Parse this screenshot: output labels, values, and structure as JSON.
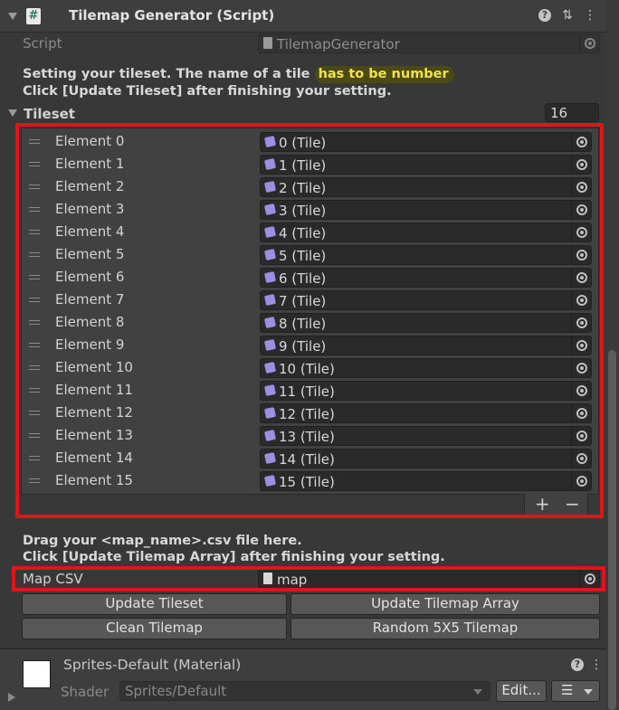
{
  "component": {
    "title": "Tilemap Generator (Script)",
    "script_label": "Script",
    "script_value": "TilemapGenerator",
    "help_line1_a": "Setting your tileset. The name of a tile ",
    "help_line1_highlight": "has to be number",
    "help_line2": "Click [Update Tileset] after finishing your setting.",
    "tileset_label": "Tileset",
    "tileset_size": "16",
    "elements": [
      {
        "name": "Element 0",
        "value": "0 (Tile)"
      },
      {
        "name": "Element 1",
        "value": "1 (Tile)"
      },
      {
        "name": "Element 2",
        "value": "2 (Tile)"
      },
      {
        "name": "Element 3",
        "value": "3 (Tile)"
      },
      {
        "name": "Element 4",
        "value": "4 (Tile)"
      },
      {
        "name": "Element 5",
        "value": "5 (Tile)"
      },
      {
        "name": "Element 6",
        "value": "6 (Tile)"
      },
      {
        "name": "Element 7",
        "value": "7 (Tile)"
      },
      {
        "name": "Element 8",
        "value": "8 (Tile)"
      },
      {
        "name": "Element 9",
        "value": "9 (Tile)"
      },
      {
        "name": "Element 10",
        "value": "10 (Tile)"
      },
      {
        "name": "Element 11",
        "value": "11 (Tile)"
      },
      {
        "name": "Element 12",
        "value": "12 (Tile)"
      },
      {
        "name": "Element 13",
        "value": "13 (Tile)"
      },
      {
        "name": "Element 14",
        "value": "14 (Tile)"
      },
      {
        "name": "Element 15",
        "value": "15 (Tile)"
      }
    ],
    "add_symbol": "+",
    "remove_symbol": "−",
    "csv_help_line1": "Drag your <map_name>.csv file here.",
    "csv_help_line2": "Click [Update Tilemap Array] after finishing your setting.",
    "map_csv_label": "Map CSV",
    "map_csv_value": "map",
    "buttons": {
      "update_tileset": "Update Tileset",
      "update_tilemap_array": "Update Tilemap Array",
      "clean_tilemap": "Clean Tilemap",
      "random_tilemap": "Random 5X5 Tilemap"
    }
  },
  "material": {
    "title": "Sprites-Default (Material)",
    "shader_label": "Shader",
    "shader_value": "Sprites/Default",
    "edit_label": "Edit..."
  },
  "icons": {
    "script": "#",
    "help": "?",
    "presets": "⇅",
    "menu": "⋮",
    "list": "☰"
  },
  "colors": {
    "highlight_text": "#f1e24a",
    "highlight_bg": "#4b4a17",
    "annotation_red": "#e0141a",
    "tile_icon": "#9e8de0"
  }
}
